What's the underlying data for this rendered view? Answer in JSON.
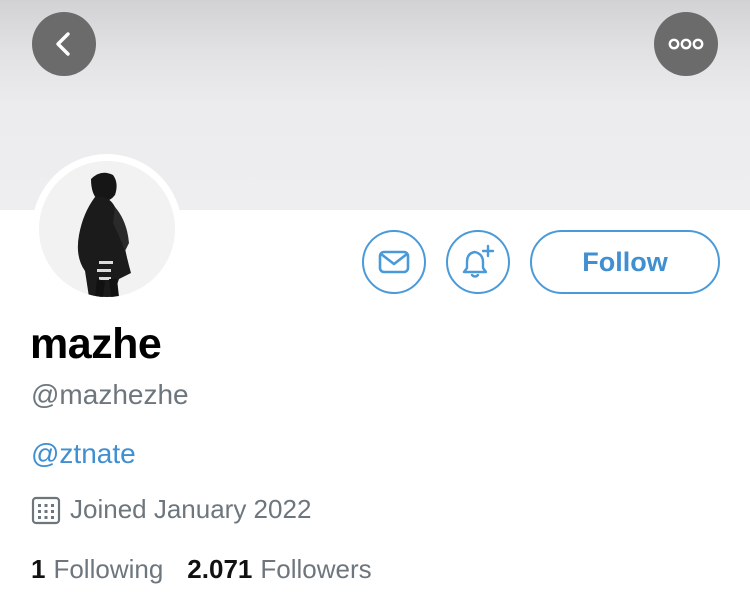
{
  "header": {
    "back_icon": "chevron-left-icon",
    "more_icon": "ellipsis-icon",
    "banner_color": "#eeeef0"
  },
  "profile": {
    "avatar": "profile-photo",
    "display_name": "mazhe",
    "handle": "@mazhezhe",
    "bio_link": "@ztnate",
    "joined_text": "Joined January 2022",
    "joined_icon": "calendar-icon"
  },
  "actions": {
    "message_icon": "envelope-icon",
    "notify_icon": "bell-plus-icon",
    "follow_label": "Follow",
    "accent_color": "#4a9ad9"
  },
  "stats": {
    "following_count": "1",
    "following_label": "Following",
    "followers_count": "2.071",
    "followers_label": "Followers"
  }
}
